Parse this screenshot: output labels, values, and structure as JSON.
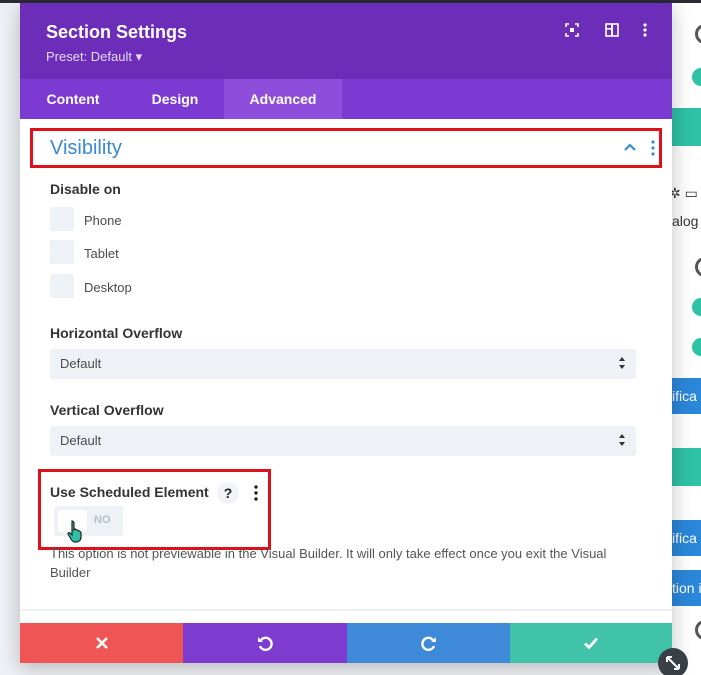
{
  "background": {
    "texts": [
      "alog",
      "ifica",
      "ifica",
      "tion i"
    ]
  },
  "modal": {
    "title": "Section Settings",
    "preset": "Preset: Default ▾",
    "tabs": [
      {
        "label": "Content",
        "active": false
      },
      {
        "label": "Design",
        "active": false
      },
      {
        "label": "Advanced",
        "active": true
      }
    ],
    "header_icons": [
      "fullscreen-icon",
      "split-view-icon",
      "more-options-icon"
    ]
  },
  "visibility": {
    "title": "Visibility",
    "disable_on_label": "Disable on",
    "options": [
      {
        "label": "Phone",
        "checked": false
      },
      {
        "label": "Tablet",
        "checked": false
      },
      {
        "label": "Desktop",
        "checked": false
      }
    ],
    "horizontal_overflow": {
      "label": "Horizontal Overflow",
      "value": "Default"
    },
    "vertical_overflow": {
      "label": "Vertical Overflow",
      "value": "Default"
    },
    "scheduled": {
      "label": "Use Scheduled Element",
      "help": "?",
      "toggle_text": "NO",
      "enabled": false
    },
    "note": "This option is not previewable in the Visual Builder. It will only take effect once you exit the Visual Builder"
  },
  "footer": {
    "buttons": [
      {
        "name": "cancel",
        "icon": "close-icon",
        "color": "#ef5555"
      },
      {
        "name": "undo",
        "icon": "undo-icon",
        "color": "#7d3bcf"
      },
      {
        "name": "redo",
        "icon": "redo-icon",
        "color": "#3e8ad8"
      },
      {
        "name": "save",
        "icon": "check-icon",
        "color": "#41c3a9"
      }
    ]
  },
  "colors": {
    "header": "#6c2eb9",
    "tabs": "#7b3ad1",
    "accent_title": "#3a88d6",
    "highlight_border": "#e0101b"
  }
}
